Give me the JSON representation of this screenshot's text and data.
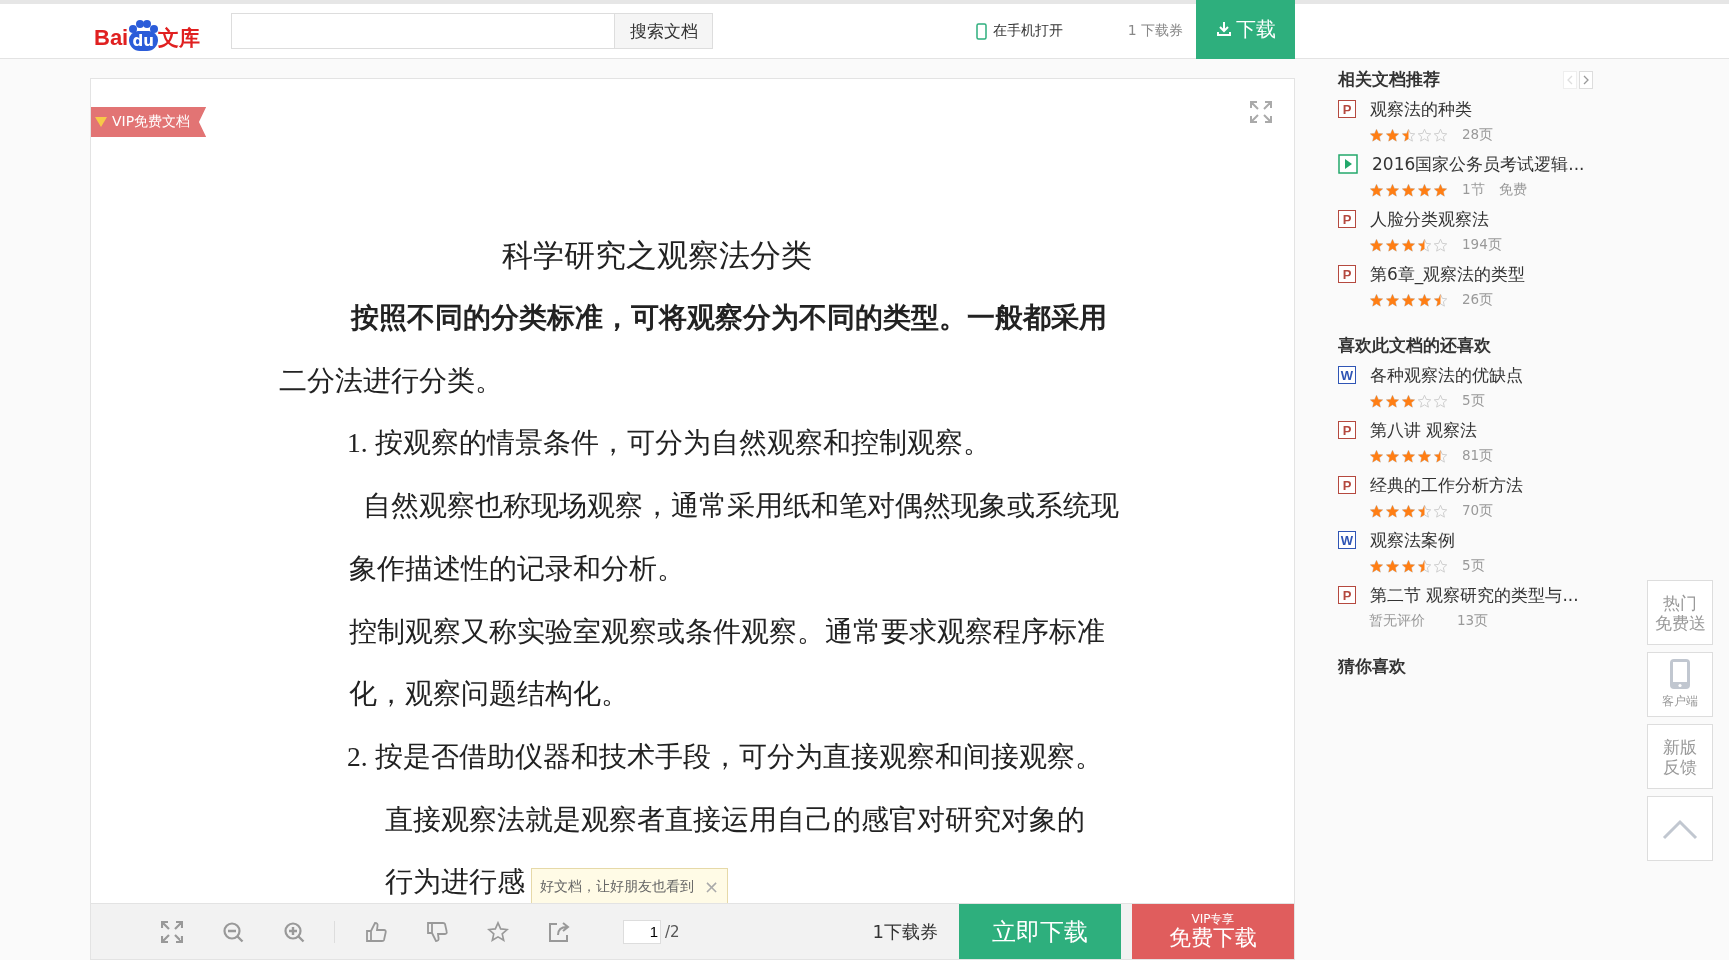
{
  "header": {
    "logo": [
      "Bai",
      "du",
      "文库"
    ],
    "search": {
      "button": "搜索文档"
    },
    "mobile_link": "在手机打开",
    "coupons": "1 下载券",
    "download_button": "下载"
  },
  "document": {
    "badge": "VIP免费文档",
    "title": "科学研究之观察法分类",
    "lines": [
      {
        "kind": "lead",
        "text": "按照不同的分类标准，可将观察分为不同的类型。一般都采用"
      },
      {
        "kind": "wrap",
        "text": "二分法进行分类。"
      },
      {
        "kind": "item",
        "text": "1. 按观察的情景条件，可分为自然观察和控制观察。"
      },
      {
        "kind": "sub",
        "text": "自然观察也称现场观察，通常采用纸和笔对偶然现象或系统现"
      },
      {
        "kind": "subwrap",
        "text": "象作描述性的记录和分析。"
      },
      {
        "kind": "subwrap",
        "text": "控制观察又称实验室观察或条件观察。通常要求观察程序标准"
      },
      {
        "kind": "subwrap",
        "text": "化，观察问题结构化。"
      },
      {
        "kind": "item",
        "text": "2. 按是否借助仪器和技术手段，可分为直接观察和间接观察。"
      },
      {
        "kind": "note",
        "text": "直接观察法就是观察者直接运用自己的感官对研究对象的"
      },
      {
        "kind": "note",
        "text": "行为进行感"
      }
    ]
  },
  "toolbar": {
    "page": "1",
    "total": "/2",
    "coupons": "1下载券",
    "download_button": "立即下载",
    "vip_button": {
      "tag": "VIP专享",
      "label": "免费下载"
    },
    "tooltip": "好文档，让好朋友也看到",
    "tooltip_close": "×"
  },
  "sidebar": {
    "sections": [
      {
        "title": "相关文档推荐",
        "items": [
          {
            "kind": "ppt",
            "icon": "P",
            "title": "观察法的种类",
            "stars": 2.5,
            "meta": [
              "28页"
            ]
          },
          {
            "kind": "video",
            "title": "2016国家公务员考试逻辑...",
            "stars": 5,
            "meta": [
              "1节",
              "免费"
            ]
          },
          {
            "kind": "ppt",
            "icon": "P",
            "title": "人脸分类观察法",
            "stars": 3.5,
            "meta": [
              "194页"
            ]
          },
          {
            "kind": "ppt",
            "icon": "P",
            "title": "第6章_观察法的类型",
            "stars": 4.5,
            "meta": [
              "26页"
            ]
          }
        ]
      },
      {
        "title": "喜欢此文档的还喜欢",
        "items": [
          {
            "kind": "word",
            "icon": "W",
            "title": "各种观察法的优缺点",
            "stars": 3,
            "meta": [
              "5页"
            ]
          },
          {
            "kind": "ppt",
            "icon": "P",
            "title": "第八讲 观察法",
            "stars": 4.5,
            "meta": [
              "81页"
            ]
          },
          {
            "kind": "ppt",
            "icon": "P",
            "title": "经典的工作分析方法",
            "stars": 3.5,
            "meta": [
              "70页"
            ]
          },
          {
            "kind": "word",
            "icon": "W",
            "title": "观察法案例",
            "stars": 3.5,
            "meta": [
              "5页"
            ]
          },
          {
            "kind": "ppt",
            "icon": "P",
            "title": "第二节 观察研究的类型与...",
            "rating_text": "暂无评价",
            "meta": [
              "13页"
            ]
          }
        ]
      },
      {
        "title": "猜你喜欢"
      }
    ]
  },
  "floating": [
    {
      "kind": "text",
      "lines": [
        "热门",
        "免费送"
      ]
    },
    {
      "kind": "app",
      "label": "客户端"
    },
    {
      "kind": "text",
      "lines": [
        "新版",
        "反馈"
      ]
    },
    {
      "kind": "top"
    }
  ]
}
